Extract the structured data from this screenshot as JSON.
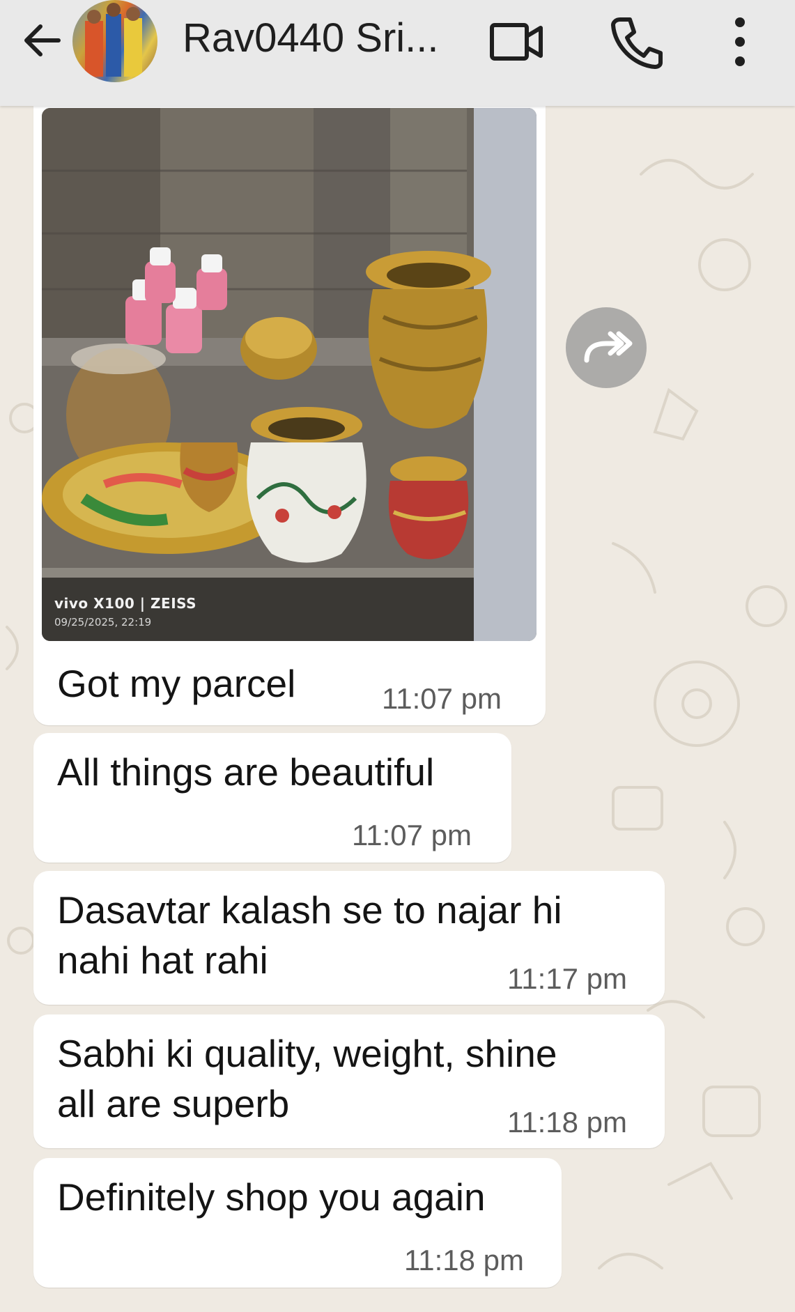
{
  "header": {
    "contact_name": "Rav0440 Sri...",
    "icons": {
      "back": "arrow-left-icon",
      "avatar": "contact-avatar",
      "video": "video-call-icon",
      "call": "phone-icon",
      "more": "more-vertical-icon"
    }
  },
  "photo": {
    "watermark_brand": "vivo X100 | ZEISS",
    "watermark_datetime": "09/25/2025, 22:19",
    "forward_icon": "forward-icon"
  },
  "messages": [
    {
      "text": "Got my parcel",
      "time": "11:07 pm"
    },
    {
      "text": "All things are beautiful",
      "time": "11:07 pm"
    },
    {
      "text": "Dasavtar kalash se to najar hi\nnahi hat rahi",
      "time": "11:17 pm"
    },
    {
      "text": "Sabhi ki quality, weight, shine\nall are superb",
      "time": "11:18 pm"
    },
    {
      "text": "Definitely shop you again",
      "time": "11:18 pm"
    }
  ],
  "colors": {
    "header_bg": "#e9e9e9",
    "chat_bg": "#efeae2",
    "bubble_bg": "#ffffff",
    "text": "#141414",
    "timestamp": "#5c5c5c"
  }
}
